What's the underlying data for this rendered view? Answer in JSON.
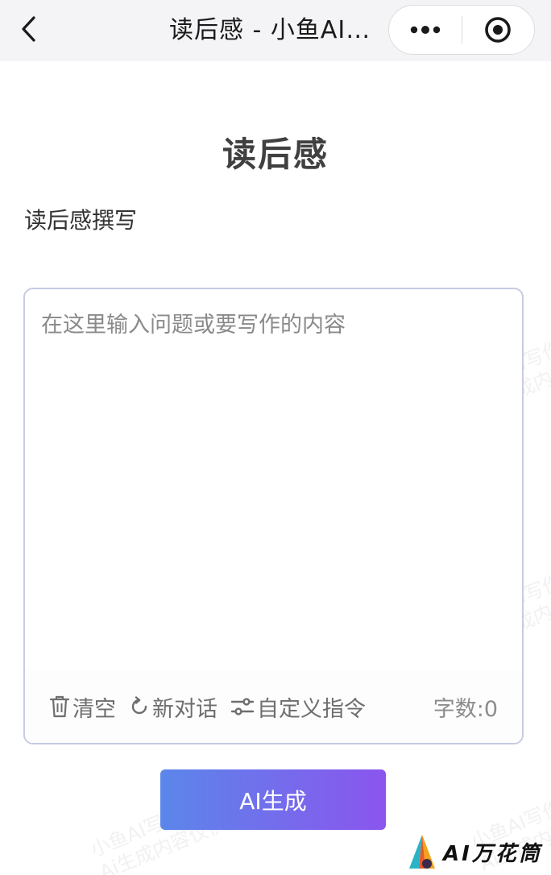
{
  "navbar": {
    "title": "读后感 - 小鱼AI写作"
  },
  "page": {
    "title": "读后感",
    "subtitle": "读后感撰写"
  },
  "editor": {
    "placeholder": "在这里输入问题或要写作的内容",
    "value": ""
  },
  "toolbar": {
    "clear_label": "清空",
    "new_chat_label": "新对话",
    "custom_label": "自定义指令",
    "word_count": "字数:0"
  },
  "generate_button": "AI生成",
  "watermark": {
    "line1": "小鱼AI写作",
    "line2": "Ai生成内容仅供参考"
  },
  "corner_logo": "AI万花筒",
  "colors": {
    "border": "#c7cbe2",
    "button_gradient_start": "#5b86ea",
    "button_gradient_end": "#8b55ee",
    "title": "#404040"
  }
}
